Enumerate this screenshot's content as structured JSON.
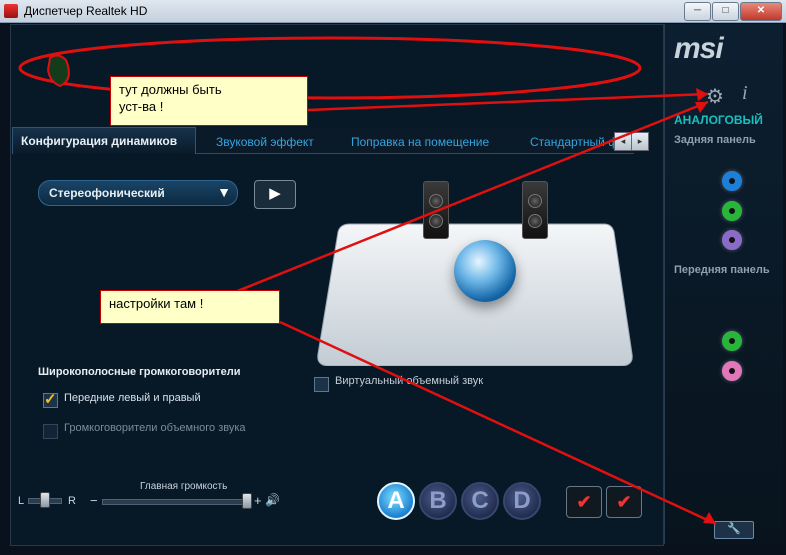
{
  "window": {
    "title": "Диспетчер Realtek HD",
    "minimize": "─",
    "maximize": "□",
    "close": "✕"
  },
  "brand": {
    "logo": "msi"
  },
  "right_panel": {
    "analog": "АНАЛОГОВЫЙ",
    "rear_panel": "Задняя панель",
    "front_panel": "Передняя панель",
    "rear_jacks": [
      "#1e7fd8",
      "#29b53c",
      "#8a6bc8"
    ],
    "front_jacks": [
      "#29b53c",
      "#e078b8"
    ]
  },
  "tabs": {
    "active": "Конфигурация динамиков",
    "items": [
      "Звуковой эффект",
      "Поправка на помещение",
      "Стандартный ф"
    ]
  },
  "config": {
    "speaker_select": "Стереофонический",
    "play_icon": "▶"
  },
  "options": {
    "section_title": "Широкополосные громкоговорители",
    "front_lr": "Передние левый и правый",
    "surround": "Громкоговорители объемного звука",
    "virtual_surround": "Виртуальный объемный звук"
  },
  "volume": {
    "label": "Главная громкость",
    "left": "L",
    "right": "R",
    "minus": "−",
    "plus": "+",
    "speaker_icon": "🔊"
  },
  "letters": [
    "A",
    "B",
    "C",
    "D"
  ],
  "notes": {
    "note1": "тут должны быть\nуст-ва !",
    "note2": "настройки там !"
  }
}
